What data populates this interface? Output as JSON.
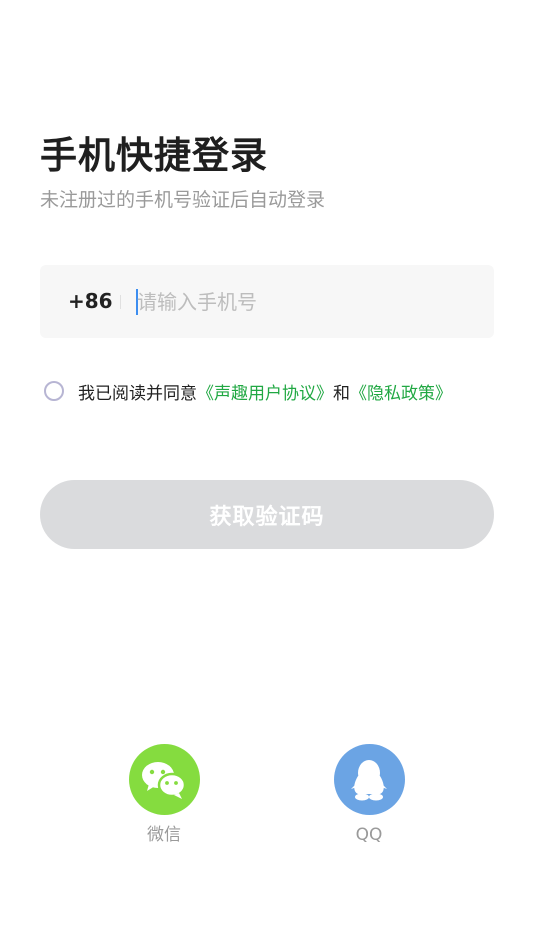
{
  "header": {
    "title": "手机快捷登录",
    "subtitle": "未注册过的手机号验证后自动登录"
  },
  "phone": {
    "country_code": "+86",
    "placeholder": "请输入手机号",
    "value": ""
  },
  "agreement": {
    "prefix": "我已阅读并同意",
    "link1": "《声趣用户协议》",
    "conjunction": "和",
    "link2": "《隐私政策》",
    "checked": false
  },
  "actions": {
    "get_code": "获取验证码"
  },
  "social": {
    "wechat": {
      "label": "微信",
      "icon": "wechat-icon",
      "color": "#85dc3f"
    },
    "qq": {
      "label": "QQ",
      "icon": "qq-icon",
      "color": "#6ba4e4"
    }
  },
  "colors": {
    "link": "#21a843",
    "cursor": "#3d8ef0",
    "button_disabled": "#dadbdd"
  }
}
